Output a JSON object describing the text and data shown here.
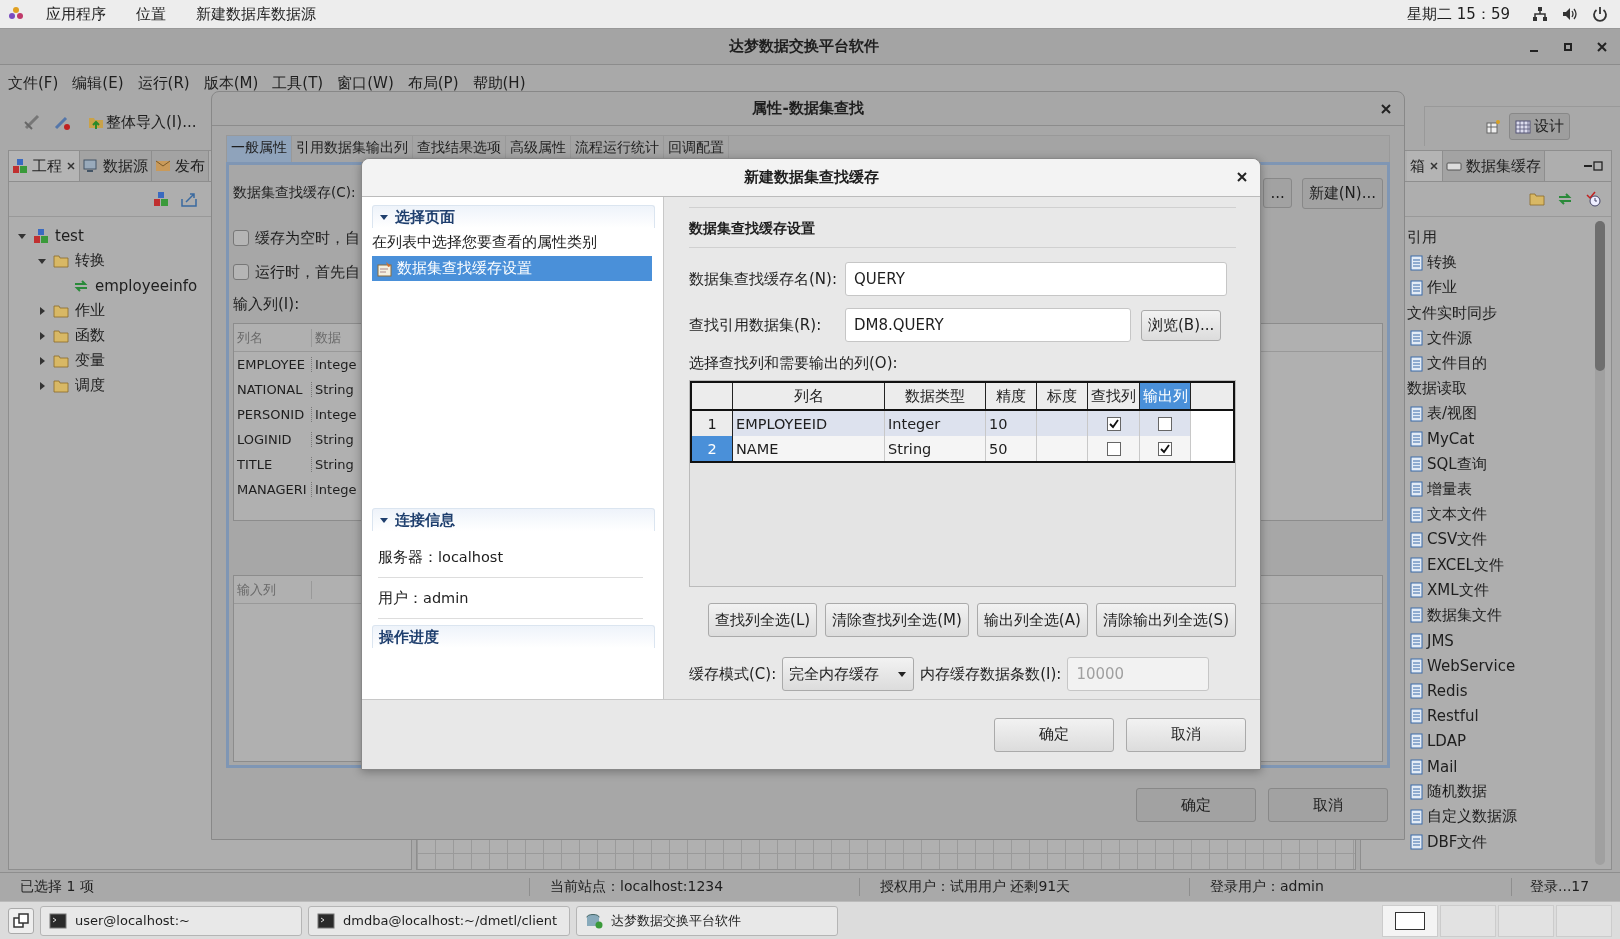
{
  "top_bar": {
    "applications": "应用程序",
    "places": "位置",
    "active_app": "新建数据库数据源",
    "clock": "星期二 15：59"
  },
  "window": {
    "title": "达梦数据交换平台软件"
  },
  "menu": [
    "文件(F)",
    "编辑(E)",
    "运行(R)",
    "版本(M)",
    "工具(T)",
    "窗口(W)",
    "布局(P)",
    "帮助(H)"
  ],
  "toolbar": {
    "import_button": "整体导入(I)...",
    "design_button": "设计"
  },
  "left_panel": {
    "tabs": [
      {
        "label": "工程",
        "selected": true
      },
      {
        "label": "数据源",
        "selected": false
      },
      {
        "label": "发布",
        "selected": false
      }
    ],
    "tree": [
      {
        "label": "test",
        "kind": "project",
        "expanded": true,
        "children": [
          {
            "label": "转换",
            "kind": "folder",
            "expanded": true,
            "children": [
              {
                "label": "employeeinfo",
                "kind": "transform"
              }
            ]
          },
          {
            "label": "作业",
            "kind": "folder",
            "expanded": false
          },
          {
            "label": "函数",
            "kind": "folder",
            "expanded": false
          },
          {
            "label": "变量",
            "kind": "folder",
            "expanded": false
          },
          {
            "label": "调度",
            "kind": "folder",
            "expanded": false
          }
        ]
      }
    ]
  },
  "right_panel": {
    "tabs": [
      {
        "label": "箱",
        "selected": true
      },
      {
        "label": "数据集缓存",
        "selected": false
      }
    ],
    "items": [
      {
        "label": "引用",
        "kind": "group"
      },
      {
        "label": "转换",
        "kind": "item"
      },
      {
        "label": "作业",
        "kind": "item"
      },
      {
        "label": "文件实时同步",
        "kind": "group"
      },
      {
        "label": "文件源",
        "kind": "item"
      },
      {
        "label": "文件目的",
        "kind": "item"
      },
      {
        "label": "数据读取",
        "kind": "group"
      },
      {
        "label": "表/视图",
        "kind": "item"
      },
      {
        "label": "MyCat",
        "kind": "item"
      },
      {
        "label": "SQL查询",
        "kind": "item"
      },
      {
        "label": "增量表",
        "kind": "item"
      },
      {
        "label": "文本文件",
        "kind": "item"
      },
      {
        "label": "CSV文件",
        "kind": "item"
      },
      {
        "label": "EXCEL文件",
        "kind": "item"
      },
      {
        "label": "XML文件",
        "kind": "item"
      },
      {
        "label": "数据集文件",
        "kind": "item"
      },
      {
        "label": "JMS",
        "kind": "item"
      },
      {
        "label": "WebService",
        "kind": "item"
      },
      {
        "label": "Redis",
        "kind": "item"
      },
      {
        "label": "Restful",
        "kind": "item"
      },
      {
        "label": "LDAP",
        "kind": "item"
      },
      {
        "label": "Mail",
        "kind": "item"
      },
      {
        "label": "随机数据",
        "kind": "item"
      },
      {
        "label": "自定义数据源",
        "kind": "item"
      },
      {
        "label": "DBF文件",
        "kind": "item"
      }
    ]
  },
  "status_bar": [
    "已选择 1 项",
    "当前站点：localhost:1234",
    "授权用户：试用用户 还剩91天",
    "登录用户：admin",
    "登录...17"
  ],
  "workspaces": [
    {
      "selected": true
    },
    {
      "selected": false
    },
    {
      "selected": false
    },
    {
      "selected": false
    }
  ],
  "taskbar": [
    {
      "label": "user@localhost:~",
      "kind": "terminal"
    },
    {
      "label": "dmdba@localhost:~/dmetl/client",
      "kind": "terminal"
    },
    {
      "label": "达梦数据交换平台软件",
      "kind": "app"
    }
  ],
  "property_dialog": {
    "title": "属性-数据集查找",
    "tabs": [
      {
        "label": "一般属性",
        "selected": true
      },
      {
        "label": "引用数据集输出列",
        "selected": false
      },
      {
        "label": "查找结果选项",
        "selected": false
      },
      {
        "label": "高级属性",
        "selected": false
      },
      {
        "label": "流程运行统计",
        "selected": false
      },
      {
        "label": "回调配置",
        "selected": false
      }
    ],
    "cache_label": "数据集查找缓存(C):",
    "browse_button": "...",
    "new_button": "新建(N)...",
    "checkboxes": [
      {
        "label": "缓存为空时，自",
        "checked": false
      },
      {
        "label": "运行时，首先自",
        "checked": false
      }
    ],
    "input_columns_label": "输入列(I):",
    "columns": [
      "列名",
      "数据"
    ],
    "rows": [
      [
        "EMPLOYEE",
        "Intege"
      ],
      [
        "NATIONAL",
        "String"
      ],
      [
        "PERSONID",
        "Intege"
      ],
      [
        "LOGINID",
        "String"
      ],
      [
        "TITLE",
        "String"
      ],
      [
        "MANAGERI",
        "Intege"
      ]
    ],
    "lower_table_header": "输入列",
    "ok_button": "确定",
    "cancel_button": "取消"
  },
  "dialog": {
    "title": "新建数据集查找缓存",
    "pages_section": {
      "title": "选择页面",
      "expanded": true,
      "description": "在列表中选择您要查看的属性类别",
      "items": [
        {
          "label": "数据集查找缓存设置",
          "selected": true
        }
      ]
    },
    "connection_section": {
      "title": "连接信息",
      "expanded": true,
      "server": "服务器：localhost",
      "user": "用户：admin"
    },
    "progress_section": {
      "title": "操作进度"
    },
    "heading": "数据集查找缓存设置",
    "name_label": "数据集查找缓存名(N):",
    "name_value": "QUERY",
    "dataset_label": "查找引用数据集(R):",
    "dataset_value": "DM8.QUERY",
    "browse_button": "浏览(B)...",
    "table_label": "选择查找列和需要输出的列(O):",
    "columns": [
      {
        "label": "列名",
        "selected": false
      },
      {
        "label": "数据类型",
        "selected": false
      },
      {
        "label": "精度",
        "selected": false
      },
      {
        "label": "标度",
        "selected": false
      },
      {
        "label": "查找列",
        "selected": false
      },
      {
        "label": "输出列",
        "selected": true
      }
    ],
    "rows": [
      {
        "number": "1",
        "name": "EMPLOYEEID",
        "type": "Integer",
        "precision": "10",
        "lookup": true,
        "output": false,
        "selected": false,
        "highlighted": true
      },
      {
        "number": "2",
        "name": "NAME",
        "type": "String",
        "precision": "50",
        "lookup": false,
        "output": true,
        "selected": true,
        "highlighted": false
      }
    ],
    "buttons": [
      "查找列全选(L)",
      "清除查找列全选(M)",
      "输出列全选(A)",
      "清除输出列全选(S)"
    ],
    "cache_mode_label": "缓存模式(C):",
    "cache_mode": "完全内存缓存",
    "count_label": "内存缓存数据条数(I):",
    "count_value": "10000",
    "count_disabled": true,
    "ok_button": "确定",
    "cancel_button": "取消"
  }
}
